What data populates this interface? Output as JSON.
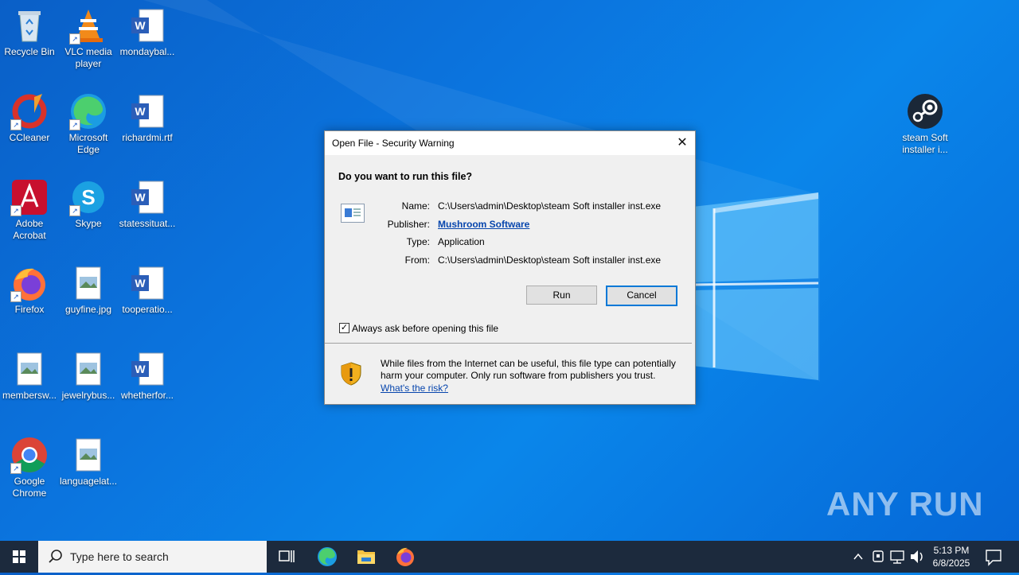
{
  "desktop": {
    "icons": [
      {
        "label": "Recycle Bin"
      },
      {
        "label": "VLC media player"
      },
      {
        "label": "mondaybal..."
      },
      {
        "label": "CCleaner"
      },
      {
        "label": "Microsoft Edge"
      },
      {
        "label": "richardmi.rtf"
      },
      {
        "label": "Adobe Acrobat"
      },
      {
        "label": "Skype"
      },
      {
        "label": "statessituat..."
      },
      {
        "label": "Firefox"
      },
      {
        "label": "guyfine.jpg"
      },
      {
        "label": "tooperatio..."
      },
      {
        "label": "membersw..."
      },
      {
        "label": "jewelrybus..."
      },
      {
        "label": "whetherfor..."
      },
      {
        "label": "Google Chrome"
      },
      {
        "label": "languagelat..."
      },
      {
        "label": "steam Soft installer i..."
      }
    ],
    "watermark": "ANY RUN"
  },
  "dialog": {
    "title": "Open File - Security Warning",
    "question": "Do you want to run this file?",
    "name_label": "Name:",
    "name_value": "C:\\Users\\admin\\Desktop\\steam Soft installer inst.exe",
    "publisher_label": "Publisher:",
    "publisher_value": "Mushroom Software",
    "type_label": "Type:",
    "type_value": "Application",
    "from_label": "From:",
    "from_value": "C:\\Users\\admin\\Desktop\\steam Soft installer inst.exe",
    "run_label": "Run",
    "cancel_label": "Cancel",
    "checkbox_label": "Always ask before opening this file",
    "checkbox_checked": true,
    "warning_text": "While files from the Internet can be useful, this file type can potentially harm your computer. Only run software from publishers you trust.",
    "risk_link": "What's the risk?"
  },
  "taskbar": {
    "search_placeholder": "Type here to search",
    "time": "5:13 PM",
    "date": "6/8/2025"
  },
  "colors": {
    "accent": "#0078d7",
    "link": "#0645ad",
    "taskbar": "#1c2a3d"
  }
}
